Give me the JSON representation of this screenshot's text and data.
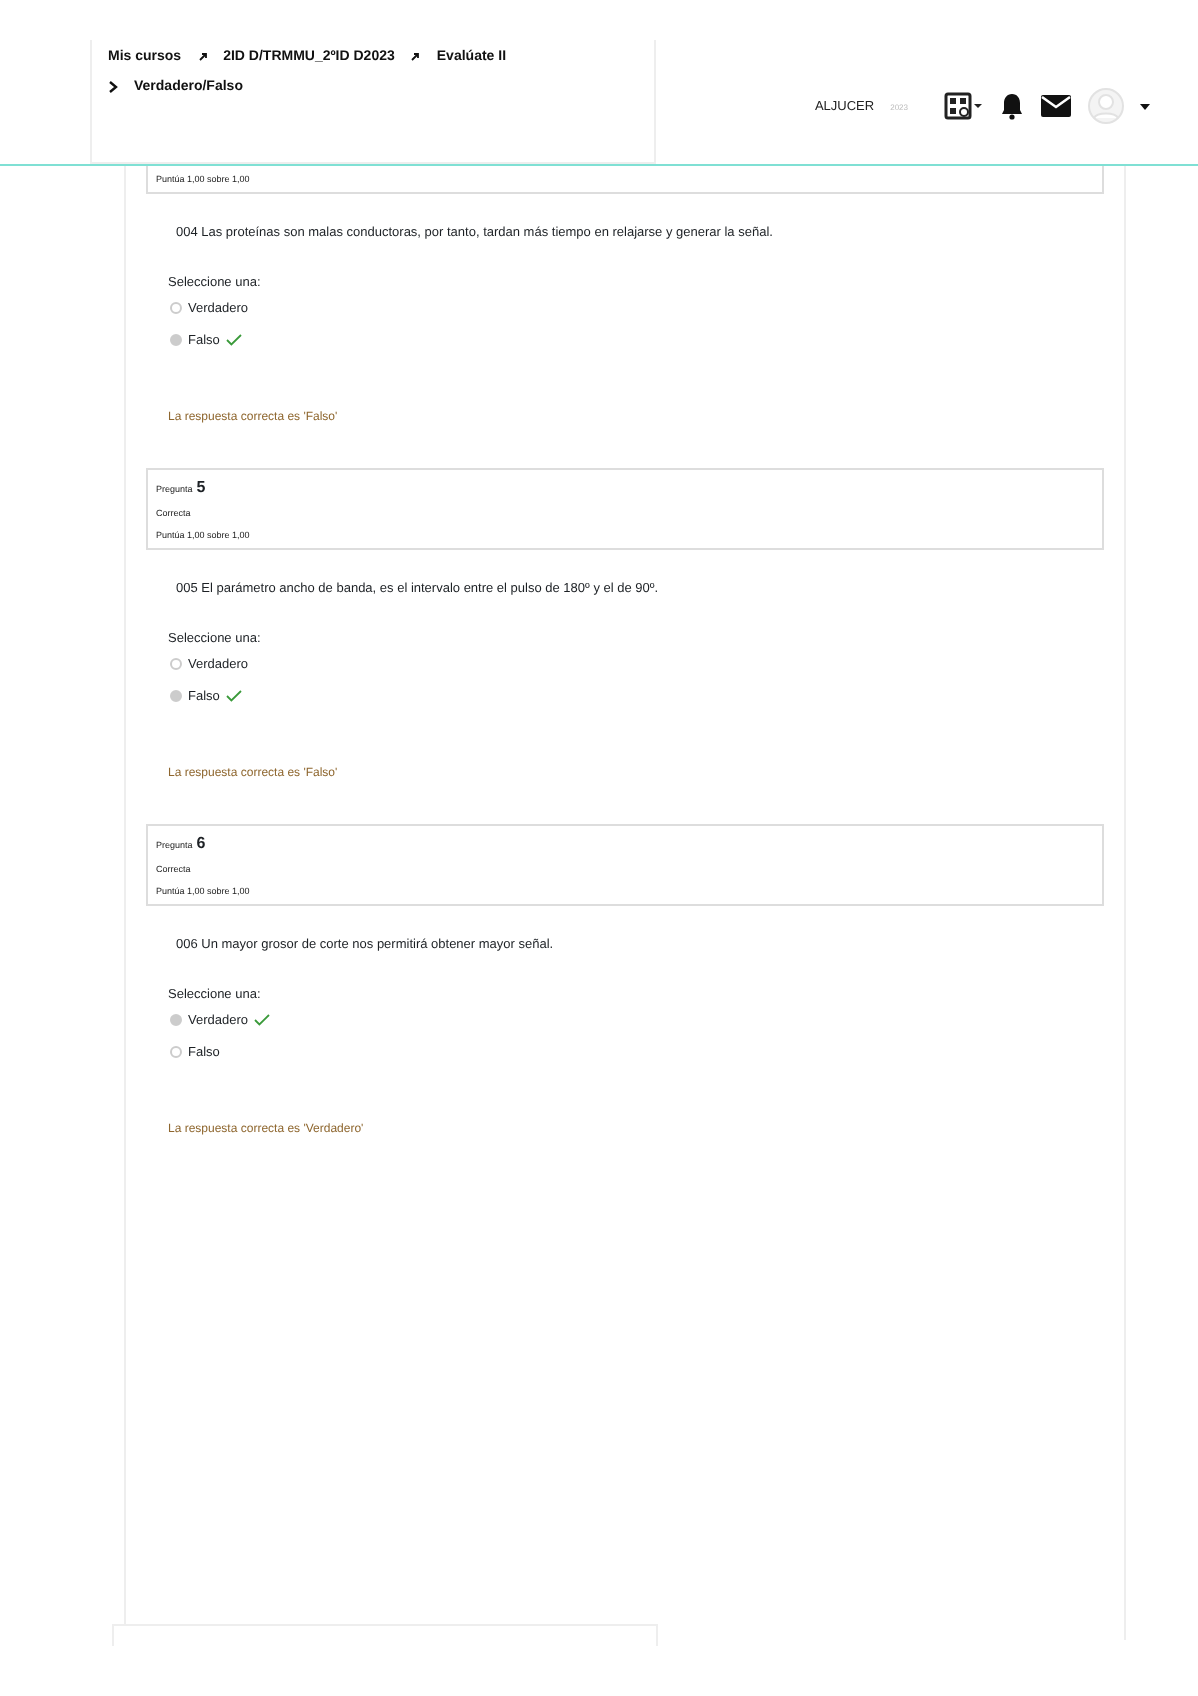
{
  "breadcrumb": {
    "items": [
      "Mis cursos",
      "2ID D/TRMMU_2ºID D2023",
      "Evalúate II"
    ],
    "current": "Verdadero/Falso"
  },
  "user": {
    "name": "ALJUCER",
    "sub": "2023"
  },
  "questions": [
    {
      "info": {
        "score": "Puntúa 1,00 sobre 1,00"
      },
      "text": "004 Las proteínas son malas conductoras, por tanto, tardan más tiempo en relajarse y generar la señal.",
      "prompt": "Seleccione una:",
      "options": [
        {
          "label": "Verdadero",
          "selected": false,
          "correct": false
        },
        {
          "label": "Falso",
          "selected": true,
          "correct": true
        }
      ],
      "feedback": "La respuesta correcta es 'Falso'"
    },
    {
      "info": {
        "label": "Pregunta",
        "number": "5",
        "status": "Correcta",
        "score": "Puntúa 1,00 sobre 1,00"
      },
      "text": "005 El parámetro ancho de banda, es el intervalo entre el pulso de 180º y el de 90º.",
      "prompt": "Seleccione una:",
      "options": [
        {
          "label": "Verdadero",
          "selected": false,
          "correct": false
        },
        {
          "label": "Falso",
          "selected": true,
          "correct": true
        }
      ],
      "feedback": "La respuesta correcta es 'Falso'"
    },
    {
      "info": {
        "label": "Pregunta",
        "number": "6",
        "status": "Correcta",
        "score": "Puntúa 1,00 sobre 1,00"
      },
      "text": "006 Un mayor grosor de corte nos permitirá obtener mayor señal.",
      "prompt": "Seleccione una:",
      "options": [
        {
          "label": "Verdadero",
          "selected": true,
          "correct": true
        },
        {
          "label": "Falso",
          "selected": false,
          "correct": false
        }
      ],
      "feedback": "La respuesta correcta es 'Verdadero'"
    }
  ]
}
